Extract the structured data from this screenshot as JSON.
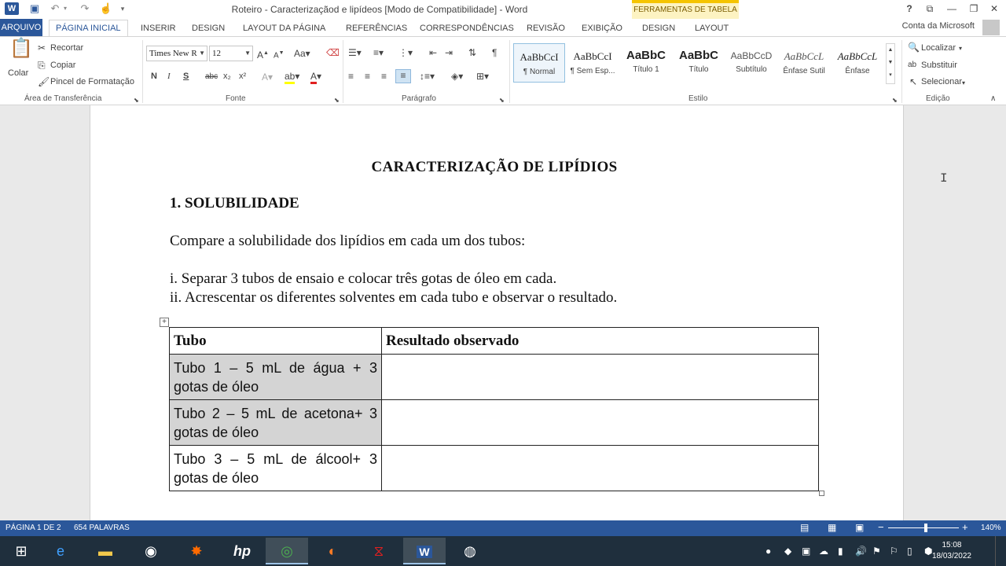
{
  "titlebar": {
    "app_icon": "W",
    "window_title": "Roteiro - Caracterizaçãod e lipídeos [Modo de Compatibilidade] - Word",
    "tools_header": "FERRAMENTAS DE TABELA",
    "help": "?",
    "icons": [
      "word-icon",
      "save-icon",
      "undo-icon",
      "redo-icon",
      "touch-mode-icon",
      "customize-qat-icon"
    ]
  },
  "tabs": {
    "file": "ARQUIVO",
    "home": "PÁGINA INICIAL",
    "insert": "INSERIR",
    "design": "DESIGN",
    "layout_page": "LAYOUT DA PÁGINA",
    "references": "REFERÊNCIAS",
    "mailings": "CORRESPONDÊNCIAS",
    "review": "REVISÃO",
    "view": "EXIBIÇÃO",
    "table_design": "DESIGN",
    "table_layout": "LAYOUT",
    "account": "Conta da Microsoft"
  },
  "clipboard": {
    "paste": "Colar",
    "cut": "Recortar",
    "copy": "Copiar",
    "format_painter": "Pincel de Formatação",
    "label": "Área de Transferência"
  },
  "font": {
    "font_name": "Times New R",
    "font_size": "12",
    "bold": "N",
    "italic": "I",
    "underline": "S",
    "strike": "abc",
    "subscript": "x₂",
    "superscript": "x²",
    "label": "Fonte"
  },
  "paragraph": {
    "label": "Parágrafo"
  },
  "styles": {
    "label": "Estilo",
    "items": [
      {
        "sample": "AaBbCcI",
        "name": "¶ Normal"
      },
      {
        "sample": "AaBbCcI",
        "name": "¶ Sem Esp..."
      },
      {
        "sample": "AaBbC",
        "name": "Título 1"
      },
      {
        "sample": "AaBbC",
        "name": "Título"
      },
      {
        "sample": "AaBbCcD",
        "name": "Subtítulo"
      },
      {
        "sample": "AaBbCcL",
        "name": "Ênfase Sutil"
      },
      {
        "sample": "AaBbCcL",
        "name": "Ênfase"
      }
    ]
  },
  "editing": {
    "find": "Localizar",
    "replace": "Substituir",
    "select": "Selecionar",
    "label": "Edição"
  },
  "document": {
    "title": "CARACTERIZAÇÃO DE LIPÍDIOS",
    "heading": "1. SOLUBILIDADE",
    "intro": "Compare a solubilidade dos lipídios em cada um dos tubos:",
    "step1": "i. Separar 3 tubos de ensaio e colocar três gotas de óleo em cada.",
    "step2": "ii. Acrescentar os diferentes solventes em cada tubo e observar o resultado.",
    "table": {
      "headers": [
        "Tubo",
        "Resultado observado"
      ],
      "rows": [
        {
          "tube": "Tubo 1 – 5 mL de água + 3 gotas de óleo",
          "result": ""
        },
        {
          "tube": "Tubo 2 – 5 mL de acetona+ 3 gotas de óleo",
          "result": ""
        },
        {
          "tube": "Tubo 3 – 5 mL de álcool+ 3 gotas de óleo",
          "result": ""
        }
      ]
    }
  },
  "status": {
    "page": "PÁGINA 1 DE 2",
    "words": "654 PALAVRAS",
    "zoom": "140%"
  },
  "taskbar": {
    "time": "15:08",
    "date": "18/03/2022",
    "apps": [
      "windows-start",
      "internet-explorer",
      "file-explorer",
      "media-app",
      "paint-app",
      "hp-app",
      "chrome",
      "firefox",
      "acrobat",
      "word",
      "obs"
    ]
  },
  "colors": {
    "accent": "#2b579a",
    "tools_tab": "#fdf3c2",
    "highlight_cell": "#d4d4d4"
  }
}
